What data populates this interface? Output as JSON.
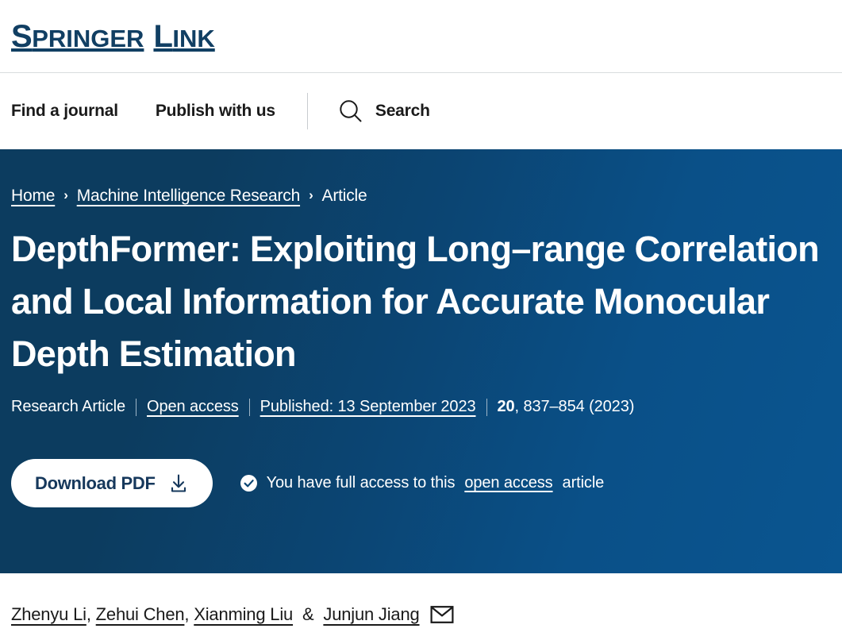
{
  "site": {
    "brand_word1": "Springer",
    "brand_word2": "Link",
    "brand_full": "SPRINGER LINK"
  },
  "nav": {
    "find_journal": "Find a journal",
    "publish": "Publish with us",
    "search_label": "Search",
    "search_icon": "search-icon"
  },
  "breadcrumb": {
    "home": "Home",
    "journal": "Machine Intelligence Research",
    "current": "Article",
    "separator": "›"
  },
  "article": {
    "title": "DepthFormer: Exploiting Long–range Correlation and Local Information for Accurate Monocular Depth Estimation",
    "type": "Research Article",
    "access": "Open access",
    "published": "Published: 13 September 2023",
    "volume": "20",
    "pages": ", 837–854 (2023)"
  },
  "actions": {
    "download_label": "Download PDF",
    "download_icon": "download-icon",
    "access_check_icon": "check-circle-icon",
    "access_text_before": "You have full access to this",
    "access_link": "open access",
    "access_text_after": "article"
  },
  "authors": {
    "list": [
      "Zhenyu Li",
      "Zehui Chen",
      "Xianming Liu",
      "Junjun Jiang"
    ],
    "comma": ",",
    "ampersand": "&",
    "contact_icon": "envelope-icon"
  },
  "colors": {
    "brand_navy": "#113f63",
    "hero_dark": "#0c3c5f",
    "hero_light": "#0a5590",
    "button_text": "#16385c",
    "divider": "#d9dcde"
  }
}
